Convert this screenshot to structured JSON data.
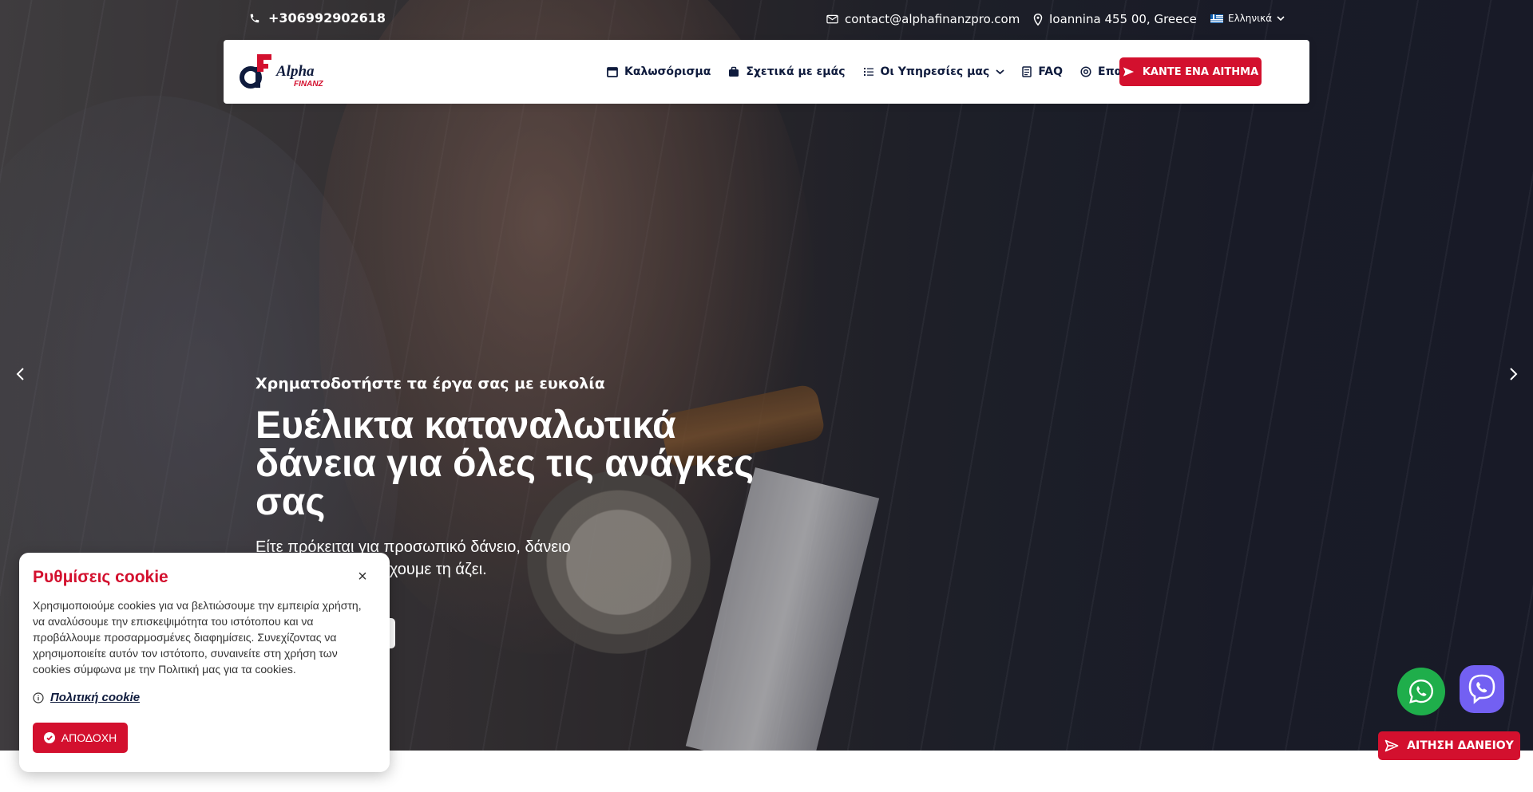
{
  "topbar": {
    "phone": "+306992902618",
    "email": "contact@alphafinanzpro.com",
    "address": "Ioannina 455 00, Greece",
    "language": "Ελληνικά"
  },
  "logo": {
    "text_main": "Alpha",
    "text_sub": "FINANZ"
  },
  "nav": {
    "items": [
      {
        "label": "Καλωσόρισμα",
        "icon": "calendar-icon"
      },
      {
        "label": "Σχετικά με εμάς",
        "icon": "briefcase-icon"
      },
      {
        "label": "Οι Υπηρεσίες μας",
        "icon": "list-icon"
      },
      {
        "label": "FAQ",
        "icon": "document-icon"
      },
      {
        "label": "Επαφή",
        "icon": "at-icon"
      }
    ],
    "cta_label": "ΚΑΝΤΕ ΕΝΑ ΑΙΤΗΜΑ"
  },
  "hero": {
    "subtitle": "Χρηματοδοτήστε τα έργα σας με ευκολία",
    "title": "Ευέλικτα καταναλωτικά δάνεια για όλες τις ανάγκες σας",
    "description": "Είτε πρόκειται για προσωπικό δάνειο, δάνειο ωτική ενοποίηση, έχουμε τη άζει."
  },
  "cookie": {
    "title": "Ρυθμίσεις cookie",
    "text": "Χρησιμοποιούμε cookies για να βελτιώσουμε την εμπειρία χρήστη, να αναλύσουμε την επισκεψιμότητα του ιστότοπου και να προβάλλουμε προσαρμοσμένες διαφημίσεις. Συνεχίζοντας να χρησιμοποιείτε αυτόν τον ιστότοπο, συναινείτε στη χρήση των cookies σύμφωνα με την Πολιτική μας για τα cookies.",
    "policy_link": "Πολιτική cookie",
    "accept_label": "ΑΠΟΔΟΧΗ",
    "close_symbol": "×"
  },
  "floating": {
    "loan_button": "ΑΙΤΗΣΗ ΔΑΝΕΙΟΥ"
  },
  "colors": {
    "accent": "#d3102e",
    "navy": "#0f1b3d",
    "whatsapp": "#1fae4b",
    "viber": "#7360f2"
  }
}
